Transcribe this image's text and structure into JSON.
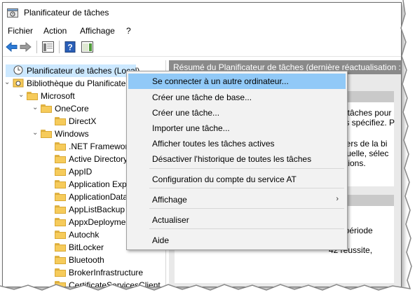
{
  "window": {
    "title": "Planificateur de tâches"
  },
  "menubar": [
    "Fichier",
    "Action",
    "Affichage",
    "?"
  ],
  "tree": [
    {
      "label": "Planificateur de tâches (Local)",
      "level": 0,
      "expander": "",
      "icon": "clock-icon",
      "selected": true
    },
    {
      "label": "Bibliothèque du Planificateur de tâches",
      "level": 0,
      "expander": "v",
      "icon": "library-icon",
      "selected": false
    },
    {
      "label": "Microsoft",
      "level": 1,
      "expander": "v",
      "icon": "folder-icon",
      "selected": false
    },
    {
      "label": "OneCore",
      "level": 2,
      "expander": "v",
      "icon": "folder-icon",
      "selected": false
    },
    {
      "label": "DirectX",
      "level": 3,
      "expander": "",
      "icon": "folder-icon",
      "selected": false
    },
    {
      "label": "Windows",
      "level": 2,
      "expander": "v",
      "icon": "folder-icon",
      "selected": false
    },
    {
      "label": ".NET Framework",
      "level": 3,
      "expander": "",
      "icon": "folder-icon",
      "selected": false
    },
    {
      "label": "Active Directory Rights Management Services Client",
      "level": 3,
      "expander": "",
      "icon": "folder-icon",
      "selected": false
    },
    {
      "label": "AppID",
      "level": 3,
      "expander": "",
      "icon": "folder-icon",
      "selected": false
    },
    {
      "label": "Application Experience",
      "level": 3,
      "expander": "",
      "icon": "folder-icon",
      "selected": false
    },
    {
      "label": "ApplicationData",
      "level": 3,
      "expander": "",
      "icon": "folder-icon",
      "selected": false
    },
    {
      "label": "AppListBackup",
      "level": 3,
      "expander": "",
      "icon": "folder-icon",
      "selected": false
    },
    {
      "label": "AppxDeploymentClient",
      "level": 3,
      "expander": "",
      "icon": "folder-icon",
      "selected": false
    },
    {
      "label": "Autochk",
      "level": 3,
      "expander": "",
      "icon": "folder-icon",
      "selected": false
    },
    {
      "label": "BitLocker",
      "level": 3,
      "expander": "",
      "icon": "folder-icon",
      "selected": false
    },
    {
      "label": "Bluetooth",
      "level": 3,
      "expander": "",
      "icon": "folder-icon",
      "selected": false
    },
    {
      "label": "BrokerInfrastructure",
      "level": 3,
      "expander": "",
      "icon": "folder-icon",
      "selected": false
    },
    {
      "label": "CertificateServicesClient",
      "level": 3,
      "expander": "",
      "icon": "folder-icon",
      "selected": false
    }
  ],
  "right": {
    "header": "Résumé du Planificateur de tâches (dernière réactualisation : ",
    "panel1": [
      "de tâches pour",
      "bus spécifiez. P",
      "ssiers de la bi",
      "viduelle, sélec",
      "Actions."
    ],
    "panel2": [
      "la période",
      "42 réussite,"
    ]
  },
  "context_menu": [
    {
      "label": "Se connecter à un autre ordinateur...",
      "highlighted": true,
      "submenu": false
    },
    {
      "label": "Créer une tâche de base...",
      "highlighted": false,
      "submenu": false
    },
    {
      "label": "Créer une tâche...",
      "highlighted": false,
      "submenu": false
    },
    {
      "label": "Importer une tâche...",
      "highlighted": false,
      "submenu": false
    },
    {
      "label": "Afficher toutes les tâches actives",
      "highlighted": false,
      "submenu": false
    },
    {
      "label": "Désactiver l'historique de toutes les tâches",
      "highlighted": false,
      "submenu": false
    },
    {
      "label": "Configuration du compte du service AT",
      "highlighted": false,
      "submenu": false
    },
    {
      "label": "Affichage",
      "highlighted": false,
      "submenu": true
    },
    {
      "label": "Actualiser",
      "highlighted": false,
      "submenu": false
    },
    {
      "label": "Aide",
      "highlighted": false,
      "submenu": false
    }
  ],
  "colors": {
    "selection": "#cce8ff",
    "menu_highlight": "#91c9f7",
    "panel_header": "#8a8a8a"
  }
}
